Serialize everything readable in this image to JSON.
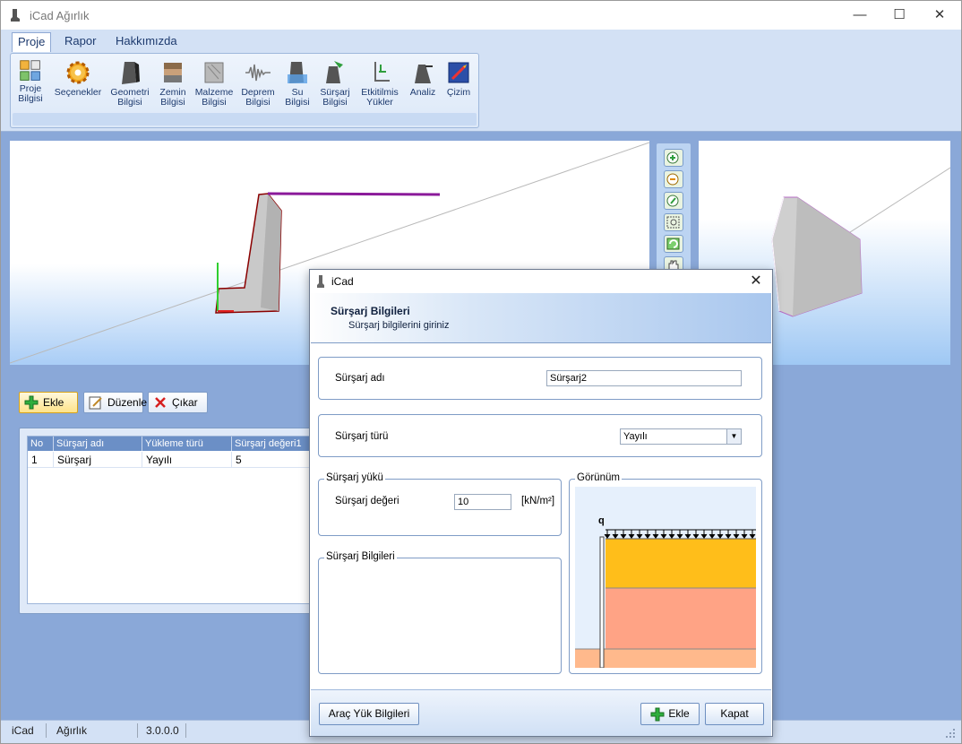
{
  "app": {
    "title": "iCad Ağırlık",
    "minimize": "—",
    "maximize": "☐",
    "close": "✕"
  },
  "ribbon": {
    "tabs": [
      {
        "label": "Proje"
      },
      {
        "label": "Rapor"
      },
      {
        "label": "Hakkımızda"
      }
    ],
    "buttons": [
      {
        "line1": "Proje",
        "line2": "Bilgisi",
        "icon": "project-icon"
      },
      {
        "line1": "Seçenekler",
        "line2": "",
        "icon": "gear-icon"
      },
      {
        "line1": "Geometri",
        "line2": "Bilgisi",
        "icon": "geometry-icon"
      },
      {
        "line1": "Zemin",
        "line2": "Bilgisi",
        "icon": "soil-icon"
      },
      {
        "line1": "Malzeme",
        "line2": "Bilgisi",
        "icon": "material-icon"
      },
      {
        "line1": "Deprem",
        "line2": "Bilgisi",
        "icon": "earthquake-icon"
      },
      {
        "line1": "Su",
        "line2": "Bilgisi",
        "icon": "water-icon"
      },
      {
        "line1": "Sürşarj",
        "line2": "Bilgisi",
        "icon": "surcharge-icon"
      },
      {
        "line1": "Etkitilmis",
        "line2": "Yükler",
        "icon": "loads-icon"
      },
      {
        "line1": "Analiz",
        "line2": "",
        "icon": "analysis-icon"
      },
      {
        "line1": "Çizim",
        "line2": "",
        "icon": "drawing-icon"
      }
    ]
  },
  "toolbar": {
    "add": "Ekle",
    "edit": "Düzenle",
    "remove": "Çıkar"
  },
  "grid": {
    "headers": [
      "No",
      "Sürşarj adı",
      "Yükleme türü",
      "Sürşarj değeri1"
    ],
    "rows": [
      [
        "1",
        "Sürşarj",
        "Yayılı",
        "5"
      ]
    ]
  },
  "status": {
    "app": "iCad",
    "module": "Ağırlık",
    "version": "3.0.0.0"
  },
  "dialog": {
    "title": "iCad",
    "heading": "Sürşarj Bilgileri",
    "subheading": "Sürşarj bilgilerini giriniz",
    "name_label": "Sürşarj adı",
    "name_value": "Sürşarj2",
    "type_label": "Sürşarj türü",
    "type_value": "Yayılı",
    "load_group": "Sürşarj yükü",
    "value_label": "Sürşarj değeri",
    "value": "10",
    "unit": "[kN/m²]",
    "info_group": "Sürşarj Bilgileri",
    "preview_group": "Görünüm",
    "preview_q": "q",
    "vehicle_button": "Araç Yük Bilgileri",
    "add_button": "Ekle",
    "close_button": "Kapat"
  }
}
